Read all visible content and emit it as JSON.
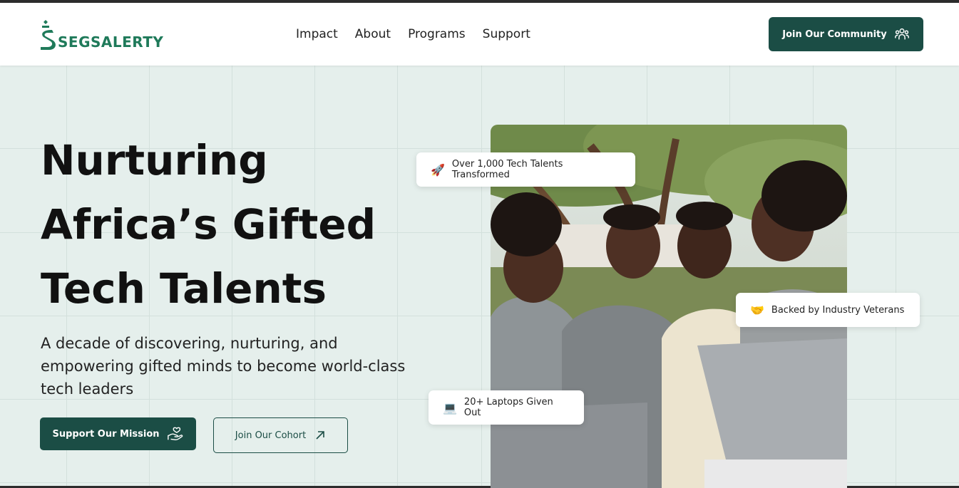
{
  "brand": {
    "name": "SEGSALERTY",
    "color": "#1f7a5a"
  },
  "nav": {
    "items": [
      {
        "label": "Impact"
      },
      {
        "label": "About"
      },
      {
        "label": "Programs"
      },
      {
        "label": "Support"
      }
    ]
  },
  "header": {
    "cta_label": "Join Our Community",
    "cta_icon": "community-icon"
  },
  "hero": {
    "title_lines": [
      "Nurturing",
      "Africa’s Gifted",
      "Tech Talents"
    ],
    "subtitle": "A decade of discovering, nurturing, and empowering gifted minds to become world-class tech leaders",
    "primary_button": {
      "label": "Support Our Mission",
      "icon": "hand-heart-icon"
    },
    "secondary_button": {
      "label": "Join Our Cohort",
      "icon": "arrow-up-right-icon"
    }
  },
  "badges": [
    {
      "emoji": "🚀",
      "text": "Over 1,000 Tech Talents Transformed"
    },
    {
      "emoji": "🤝",
      "text": "Backed by Industry Veterans"
    },
    {
      "emoji": "💻",
      "text": "20+ Laptops Given Out"
    }
  ],
  "colors": {
    "primary": "#1b4d45",
    "background": "#e5efec",
    "grid": "#d3e0dc"
  }
}
